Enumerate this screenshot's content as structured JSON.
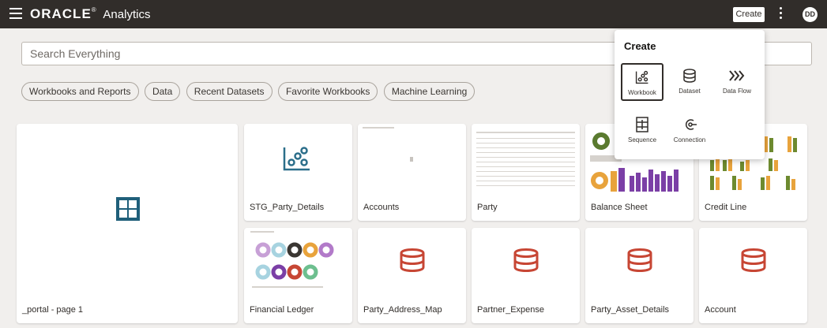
{
  "header": {
    "brand_oracle": "ORACLE",
    "brand_reg": "®",
    "brand_product": "Analytics",
    "create_label": "Create",
    "avatar_initials": "DD",
    "bg_color": "#312d2a"
  },
  "search": {
    "placeholder": "Search Everything"
  },
  "filters": [
    {
      "label": "Workbooks and Reports"
    },
    {
      "label": "Data"
    },
    {
      "label": "Recent Datasets"
    },
    {
      "label": "Favorite Workbooks"
    },
    {
      "label": "Machine Learning"
    }
  ],
  "cards": [
    {
      "label": "_portal - page 1",
      "icon": "grid-page-icon"
    },
    {
      "label": "STG_Party_Details",
      "icon": "workbook-icon"
    },
    {
      "label": "Accounts",
      "icon": "thumbnail"
    },
    {
      "label": "Party",
      "icon": "table-thumbnail"
    },
    {
      "label": "Balance Sheet",
      "icon": "chart-thumbnail"
    },
    {
      "label": "Credit Line",
      "icon": "bar-chart-thumbnail"
    },
    {
      "label": "Financial Ledger",
      "icon": "donut-thumbnail"
    },
    {
      "label": "Party_Address_Map",
      "icon": "dataset-icon"
    },
    {
      "label": "Partner_Expense",
      "icon": "dataset-icon"
    },
    {
      "label": "Party_Asset_Details",
      "icon": "dataset-icon"
    },
    {
      "label": "Account",
      "icon": "dataset-icon"
    }
  ],
  "create_menu": {
    "title": "Create",
    "items": [
      {
        "label": "Workbook",
        "icon": "workbook-icon",
        "selected": true
      },
      {
        "label": "Dataset",
        "icon": "dataset-icon"
      },
      {
        "label": "Data Flow",
        "icon": "data-flow-icon"
      },
      {
        "label": "Sequence",
        "icon": "sequence-icon"
      },
      {
        "label": "Connection",
        "icon": "connection-icon"
      }
    ]
  },
  "colors": {
    "accent_teal": "#2b6e8a",
    "dataset_red": "#c74634",
    "chart_purple": "#7b3fa6",
    "chart_orange": "#e8a33c",
    "chart_green": "#6d8a2f"
  }
}
